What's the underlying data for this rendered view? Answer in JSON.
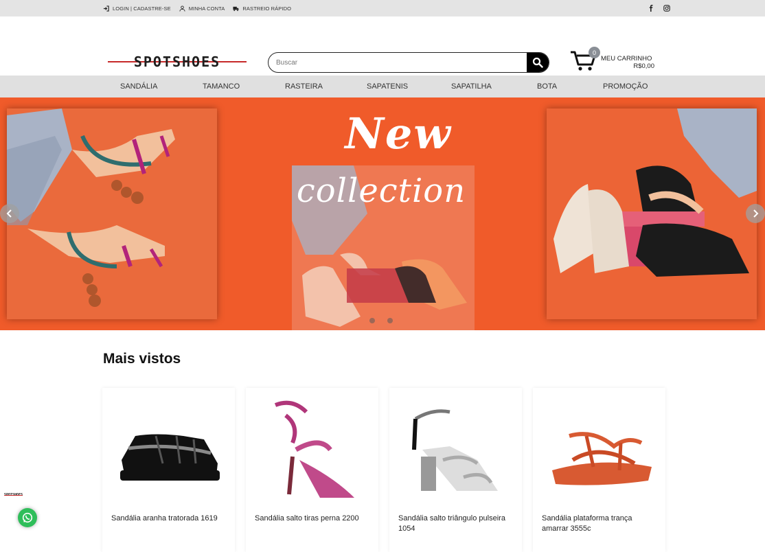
{
  "topbar": {
    "login": "LOGIN | CADASTRE-SE",
    "account": "MINHA CONTA",
    "tracking": "RASTREIO RÁPIDO",
    "social": [
      "facebook-icon",
      "instagram-icon"
    ]
  },
  "header": {
    "logo_text": "SPOTSHOES",
    "search_placeholder": "Buscar",
    "cart_count": "0",
    "cart_label": "MEU CARRINHO",
    "cart_total": "R$0,00"
  },
  "nav": {
    "items": [
      {
        "label": "SANDÁLIA"
      },
      {
        "label": "TAMANCO"
      },
      {
        "label": "RASTEIRA"
      },
      {
        "label": "SAPATENIS"
      },
      {
        "label": "SAPATILHA"
      },
      {
        "label": "BOTA"
      },
      {
        "label": "PROMOÇÃO"
      }
    ]
  },
  "hero": {
    "title": "New",
    "subtitle": "collection",
    "slides_count": 2,
    "active_slide": 0
  },
  "section": {
    "title": "Mais vistos"
  },
  "products": [
    {
      "name": "Sandália aranha tratorada 1619"
    },
    {
      "name": "Sandália salto tiras perna 2200"
    },
    {
      "name": "Sandália salto triângulo pulseira 1054"
    },
    {
      "name": "Sandália plataforma trança amarrar 3555c"
    }
  ],
  "floating": {
    "logo_text": "SPOTSHOES"
  },
  "colors": {
    "hero_bg": "#f05b2a",
    "topbar_bg": "#e4e4e4",
    "nav_bg": "#e0e0e0",
    "logo_accent": "#c62828",
    "whatsapp": "#2fbe5a"
  }
}
